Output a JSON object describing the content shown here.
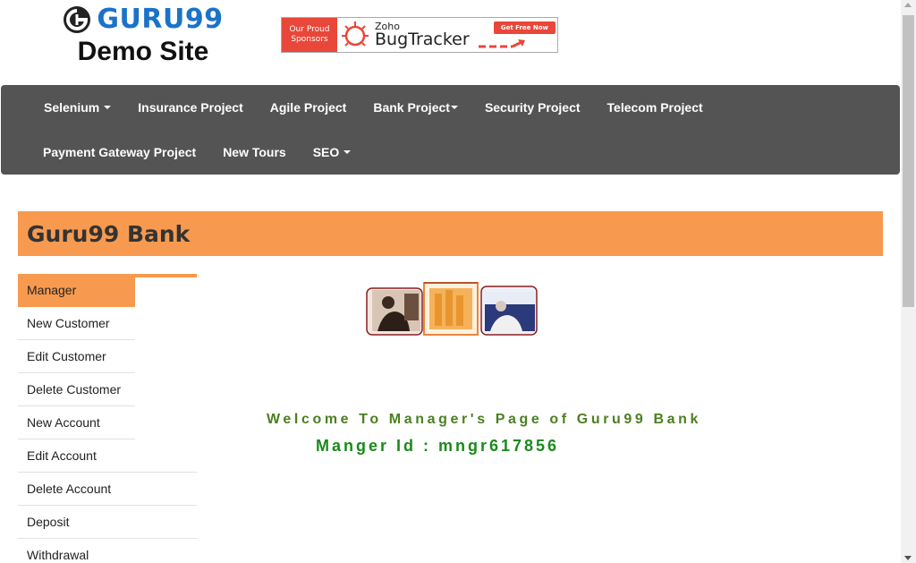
{
  "header": {
    "logo_text": "GURU99",
    "subtitle": "Demo Site"
  },
  "ad": {
    "left_text_1": "Our Proud",
    "left_text_2": "Sponsors",
    "brand_small": "Zoho",
    "brand_name": "BugTracker",
    "cta": "Get Free Now"
  },
  "nav": {
    "row1": [
      {
        "label": "Selenium",
        "dropdown": true
      },
      {
        "label": "Insurance Project",
        "dropdown": false
      },
      {
        "label": "Agile Project",
        "dropdown": false
      },
      {
        "label": "Bank Project",
        "dropdown": true
      },
      {
        "label": "Security Project",
        "dropdown": false
      },
      {
        "label": "Telecom Project",
        "dropdown": false
      }
    ],
    "row2": [
      {
        "label": "Payment Gateway Project",
        "dropdown": false
      },
      {
        "label": "New Tours",
        "dropdown": false
      },
      {
        "label": "SEO",
        "dropdown": true
      }
    ]
  },
  "bank": {
    "title": "Guru99 Bank"
  },
  "menu": {
    "items": [
      {
        "label": "Manager"
      },
      {
        "label": "New Customer"
      },
      {
        "label": "Edit Customer"
      },
      {
        "label": "Delete Customer"
      },
      {
        "label": "New Account"
      },
      {
        "label": "Edit Account"
      },
      {
        "label": "Delete Account"
      },
      {
        "label": "Deposit"
      },
      {
        "label": "Withdrawal"
      }
    ]
  },
  "main": {
    "welcome": "Welcome To Manager's Page of Guru99 Bank",
    "manager_id": "Manger Id : mngr617856"
  },
  "colors": {
    "accent": "#f79a4f",
    "nav_bg": "#545454",
    "logo_blue": "#1a73c8",
    "welcome_green": "#4b8021",
    "id_green": "#1a8a1a"
  }
}
